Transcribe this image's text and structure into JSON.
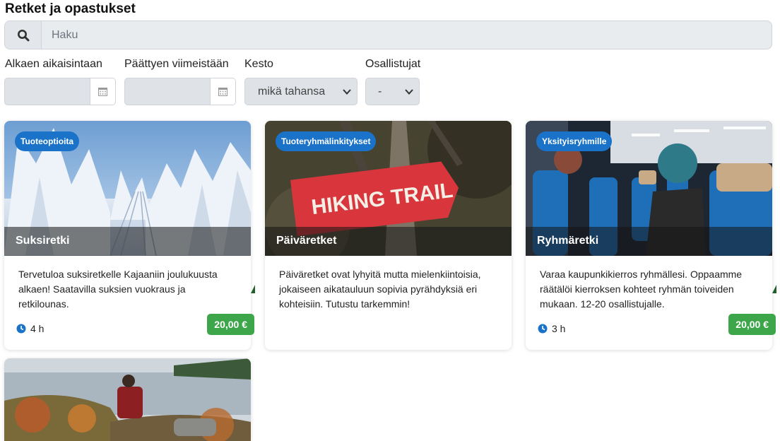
{
  "page": {
    "title": "Retket ja opastukset"
  },
  "search": {
    "placeholder": "Haku",
    "icon": "search-icon"
  },
  "filters": {
    "start_label": "Alkaen aikaisintaan",
    "end_label": "Päättyen viimeistään",
    "duration_label": "Kesto",
    "duration_value": "mikä tahansa",
    "participants_label": "Osallistujat",
    "participants_value": "-"
  },
  "colors": {
    "badge": "#1a73c8",
    "price": "#3ea64a",
    "clock": "#1a73c8"
  },
  "cards": [
    {
      "badge": "Tuoteoptioita",
      "title": "Suksiretki",
      "description": "Tervetuloa suksiretkelle Kajaaniin joulukuusta alkaen! Saatavilla suksien vuokraus ja retkilounas.",
      "duration": "4 h",
      "price": "20,00 €"
    },
    {
      "badge": "Tuoteryhmälinkitykset",
      "title": "Päiväretket",
      "description": "Päiväretket ovat lyhyitä mutta mielenkiintoisia, jokaiseen aikatauluun sopivia pyrähdyksiä eri kohteisiin. Tutustu tarkemmin!"
    },
    {
      "badge": "Yksityisryhmille",
      "title": "Ryhmäretki",
      "description": "Varaa kaupunkikierros ryhmällesi. Oppaamme räätälöi kierroksen kohteet ryhmän toiveiden mukaan. 12-20 osallistujalle.",
      "duration": "3 h",
      "price": "20,00 €"
    },
    {}
  ],
  "sign_text": "HIKING TRAIL"
}
